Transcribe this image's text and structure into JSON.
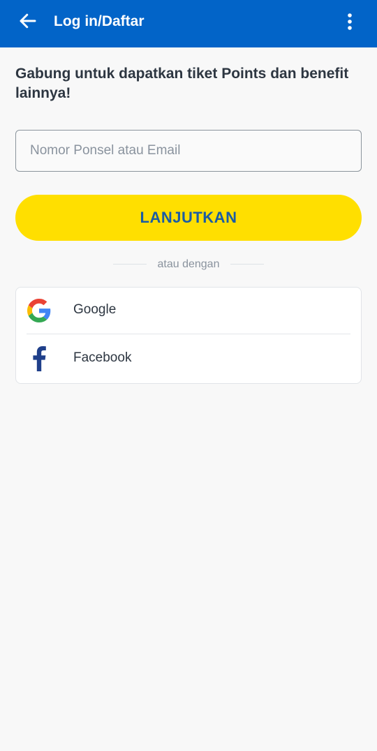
{
  "appbar": {
    "title": "Log in/Daftar",
    "back_icon": "arrow-left-icon",
    "menu_icon": "more-vertical-icon",
    "color": "#0264c8"
  },
  "headline": "Gabung untuk dapatkan tiket Points dan benefit lainnya!",
  "login_field": {
    "placeholder": "Nomor Ponsel atau Email",
    "value": ""
  },
  "continue_button": {
    "label": "LANJUTKAN",
    "color": "#ffdf00"
  },
  "divider_text": "atau dengan",
  "social_options": [
    {
      "label": "Google",
      "icon": "google-icon"
    },
    {
      "label": "Facebook",
      "icon": "facebook-icon"
    }
  ]
}
